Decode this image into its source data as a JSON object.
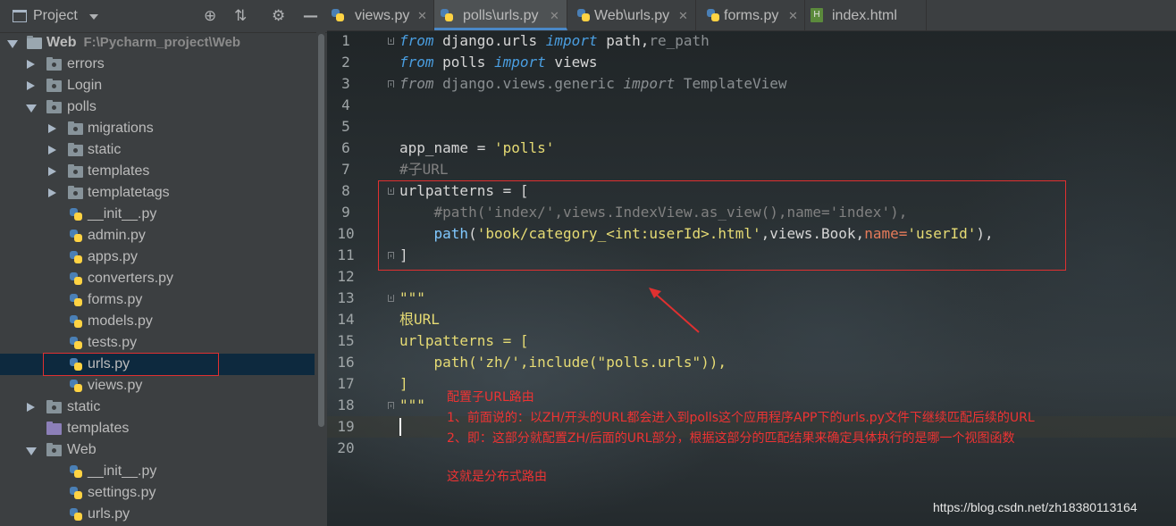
{
  "project_panel": {
    "title": "Project",
    "icons": [
      "locate-icon",
      "collapse-icon",
      "gear-icon",
      "minimize-icon"
    ],
    "tree": [
      {
        "label": "Web",
        "path": "F:\\Pycharm_project\\Web",
        "type": "folder",
        "state": "expanded"
      },
      {
        "label": "errors",
        "type": "folder",
        "state": "collapsed"
      },
      {
        "label": "Login",
        "type": "folder",
        "state": "collapsed"
      },
      {
        "label": "polls",
        "type": "folder",
        "state": "expanded"
      },
      {
        "label": "migrations",
        "type": "package",
        "state": "collapsed"
      },
      {
        "label": "static",
        "type": "package",
        "state": "collapsed"
      },
      {
        "label": "templates",
        "type": "package",
        "state": "collapsed"
      },
      {
        "label": "templatetags",
        "type": "package",
        "state": "collapsed"
      },
      {
        "label": "__init__.py",
        "type": "python"
      },
      {
        "label": "admin.py",
        "type": "python"
      },
      {
        "label": "apps.py",
        "type": "python"
      },
      {
        "label": "converters.py",
        "type": "python"
      },
      {
        "label": "forms.py",
        "type": "python"
      },
      {
        "label": "models.py",
        "type": "python"
      },
      {
        "label": "tests.py",
        "type": "python"
      },
      {
        "label": "urls.py",
        "type": "python",
        "selected": true
      },
      {
        "label": "views.py",
        "type": "python"
      },
      {
        "label": "static",
        "type": "folder",
        "state": "collapsed"
      },
      {
        "label": "templates",
        "type": "template-folder"
      },
      {
        "label": "Web",
        "type": "folder",
        "state": "expanded"
      },
      {
        "label": "__init__.py",
        "type": "python"
      },
      {
        "label": "settings.py",
        "type": "python"
      },
      {
        "label": "urls.py",
        "type": "python"
      }
    ]
  },
  "tabs": [
    {
      "label": "views.py",
      "icon": "python-file-icon",
      "active": false
    },
    {
      "label": "polls\\urls.py",
      "icon": "python-file-icon",
      "active": true
    },
    {
      "label": "Web\\urls.py",
      "icon": "python-file-icon",
      "active": false
    },
    {
      "label": "forms.py",
      "icon": "python-file-icon",
      "active": false
    },
    {
      "label": "index.html",
      "icon": "html-file-icon",
      "active": false
    }
  ],
  "editor": {
    "line_numbers": [
      "1",
      "2",
      "3",
      "4",
      "5",
      "6",
      "7",
      "8",
      "9",
      "10",
      "11",
      "12",
      "13",
      "14",
      "15",
      "16",
      "17",
      "18",
      "19",
      "20"
    ],
    "current_line": 19,
    "code": {
      "l1": {
        "a": "from",
        "b": " django.urls ",
        "c": "import",
        "d": " path,",
        "e": "re_path"
      },
      "l2": {
        "a": "from",
        "b": " polls ",
        "c": "import",
        "d": " views"
      },
      "l3": {
        "a": "from",
        "b": " django.views.generic ",
        "c": "import",
        "d": " TemplateView"
      },
      "l6": {
        "a": "app_name",
        "b": " = ",
        "c": "'polls'"
      },
      "l7": {
        "a": "#子URL"
      },
      "l8": {
        "a": "urlpatterns = ["
      },
      "l9": {
        "a": "    #path('index/',views.IndexView.as_view(),name='index'),"
      },
      "l10": {
        "a": "    ",
        "b": "path",
        "c": "(",
        "d": "'book/category_<int:userId>.html'",
        "e": ",views.Book,",
        "f": "name=",
        "g": "'userId'",
        "h": "),"
      },
      "l11": {
        "a": "]"
      },
      "l13": {
        "a": "\"\"\""
      },
      "l14": {
        "a": "根URL"
      },
      "l15": {
        "a": "urlpatterns = ["
      },
      "l16": {
        "a": "    path('zh/',include(\"polls.urls\")),"
      },
      "l17": {
        "a": "]"
      },
      "l18": {
        "a": "\"\"\""
      }
    }
  },
  "annotation": {
    "line1": "配置子URL路由",
    "line2": "1、前面说的：以ZH/开头的URL都会进入到polls这个应用程序APP下的urls.py文件下继续匹配后续的URL",
    "line3": "2、即：这部分就配置ZH/后面的URL部分，根据这部分的匹配结果来确定具体执行的是哪一个视图函数",
    "line4": "这就是分布式路由"
  },
  "watermark": "https://blog.csdn.net/zh18380113164",
  "colors": {
    "annotation_red": "#e03030",
    "keyword": "#4a9ee0",
    "string": "#e6db74",
    "selection": "#0d293e"
  }
}
